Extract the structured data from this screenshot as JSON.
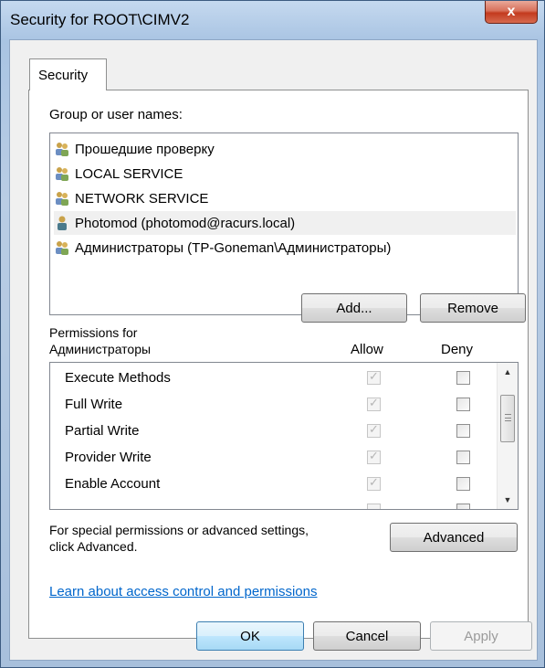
{
  "window": {
    "title": "Security for ROOT\\CIMV2",
    "close_label": "x"
  },
  "tabs": [
    {
      "label": "Security"
    }
  ],
  "group_section": {
    "label": "Group or user names:"
  },
  "users": [
    {
      "name": "Прошедшие проверку",
      "icon": "group-icon"
    },
    {
      "name": "LOCAL SERVICE",
      "icon": "group-icon"
    },
    {
      "name": "NETWORK SERVICE",
      "icon": "group-icon"
    },
    {
      "name": "Photomod (photomod@racurs.local)",
      "icon": "user-icon",
      "selected": true
    },
    {
      "name": "Администраторы (TP-Goneman\\Администраторы)",
      "icon": "group-icon"
    }
  ],
  "buttons": {
    "add": "Add...",
    "remove": "Remove",
    "advanced": "Advanced",
    "ok": "OK",
    "cancel": "Cancel",
    "apply": "Apply"
  },
  "permissions": {
    "label_line1": "Permissions for",
    "label_line2": "Администраторы",
    "allow_header": "Allow",
    "deny_header": "Deny",
    "rows": [
      {
        "name": "Execute Methods",
        "allow": true,
        "deny": false
      },
      {
        "name": "Full Write",
        "allow": true,
        "deny": false
      },
      {
        "name": "Partial Write",
        "allow": true,
        "deny": false
      },
      {
        "name": "Provider Write",
        "allow": true,
        "deny": false
      },
      {
        "name": "Enable Account",
        "allow": true,
        "deny": false
      }
    ]
  },
  "special": {
    "line1": "For special permissions or advanced settings,",
    "line2": "click Advanced."
  },
  "learn_link": "Learn about access control and permissions",
  "colors": {
    "link": "#0066cc",
    "close_button": "#c33a1e",
    "ok_border": "#3c7fb1"
  }
}
